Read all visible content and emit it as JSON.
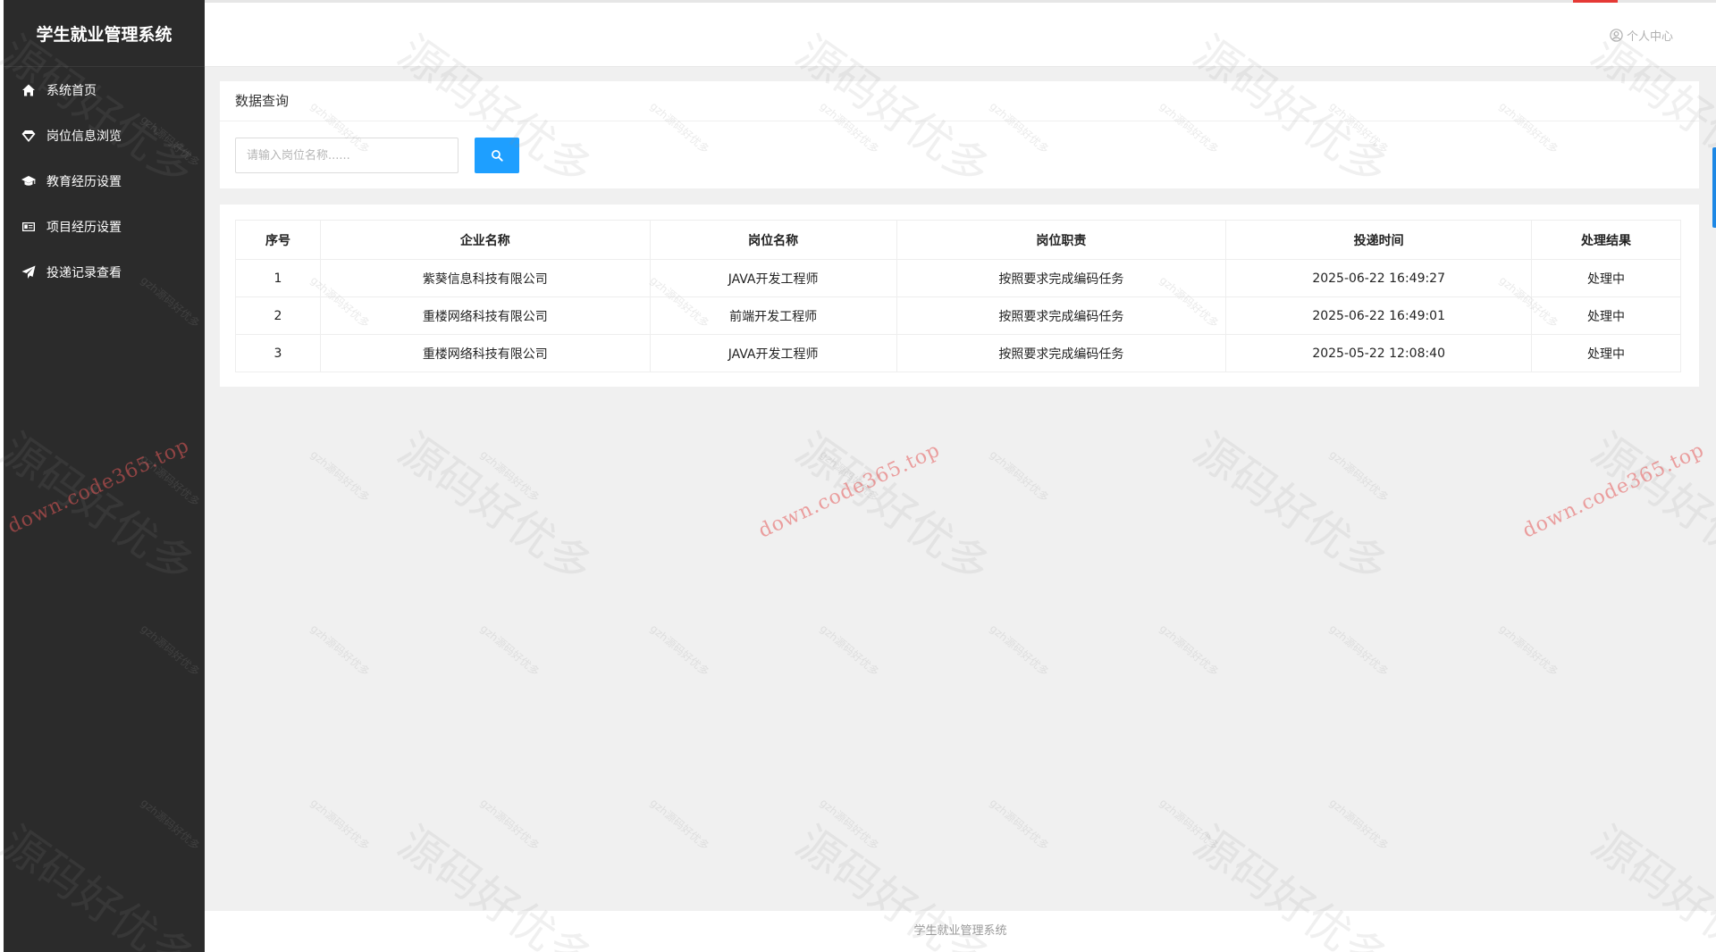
{
  "sidebar": {
    "title": "学生就业管理系统",
    "items": [
      {
        "label": "系统首页",
        "icon": "home-icon"
      },
      {
        "label": "岗位信息浏览",
        "icon": "diamond-icon"
      },
      {
        "label": "教育经历设置",
        "icon": "graduation-cap-icon"
      },
      {
        "label": "项目经历设置",
        "icon": "id-card-icon"
      },
      {
        "label": "投递记录查看",
        "icon": "send-icon"
      }
    ]
  },
  "header": {
    "user_center": "个人中心"
  },
  "search": {
    "title": "数据查询",
    "placeholder": "请输入岗位名称......",
    "value": ""
  },
  "table": {
    "columns": [
      "序号",
      "企业名称",
      "岗位名称",
      "岗位职责",
      "投递时间",
      "处理结果"
    ],
    "rows": [
      [
        "1",
        "紫葵信息科技有限公司",
        "JAVA开发工程师",
        "按照要求完成编码任务",
        "2025-06-22 16:49:27",
        "处理中"
      ],
      [
        "2",
        "重楼网络科技有限公司",
        "前端开发工程师",
        "按照要求完成编码任务",
        "2025-06-22 16:49:01",
        "处理中"
      ],
      [
        "3",
        "重楼网络科技有限公司",
        "JAVA开发工程师",
        "按照要求完成编码任务",
        "2025-05-22 12:08:40",
        "处理中"
      ]
    ]
  },
  "footer": {
    "text": "学生就业管理系统"
  },
  "watermark": {
    "text": "源码好优多",
    "url": "down.code365.top",
    "small": "gzh源码好优多"
  },
  "colors": {
    "sidebar_bg": "#2b2b2b",
    "accent": "#1e9fff",
    "page_bg": "#f0f0f0"
  }
}
